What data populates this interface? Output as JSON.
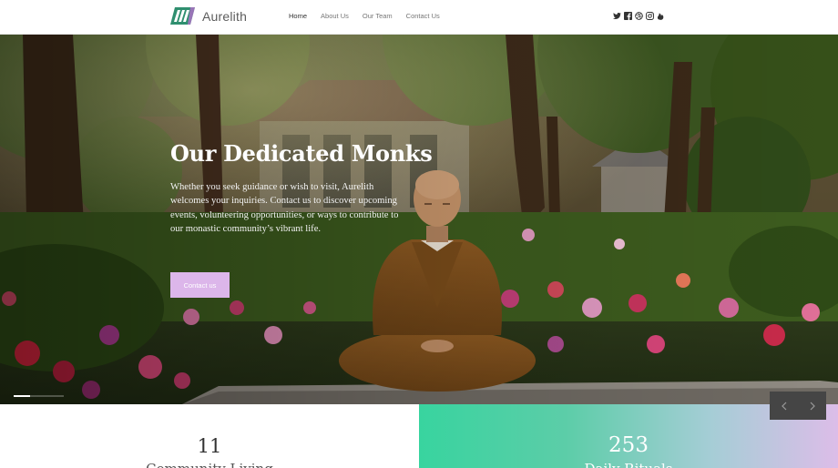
{
  "brand": {
    "name": "Aurelith"
  },
  "nav": {
    "items": [
      {
        "label": "Home",
        "active": true
      },
      {
        "label": "About Us",
        "active": false
      },
      {
        "label": "Our Team",
        "active": false
      },
      {
        "label": "Contact Us",
        "active": false
      }
    ]
  },
  "social": [
    "twitter-icon",
    "facebook-icon",
    "dribbble-icon",
    "instagram-icon",
    "behance-icon"
  ],
  "hero": {
    "title": "Our Dedicated Monks",
    "text": "Whether you seek guidance or wish to visit, Aurelith welcomes your inquiries. Contact us to discover upcoming events, volunteering opportunities, or ways to contribute to our monastic community’s vibrant life.",
    "button_label": "Contact us"
  },
  "stats": [
    {
      "number": "11",
      "label": "Community Living"
    },
    {
      "number": "253",
      "label": "Daily Rituals"
    }
  ],
  "colors": {
    "accent": "#dcb6ea",
    "gradient_start": "#38d49f",
    "gradient_end": "#dcbde8"
  }
}
